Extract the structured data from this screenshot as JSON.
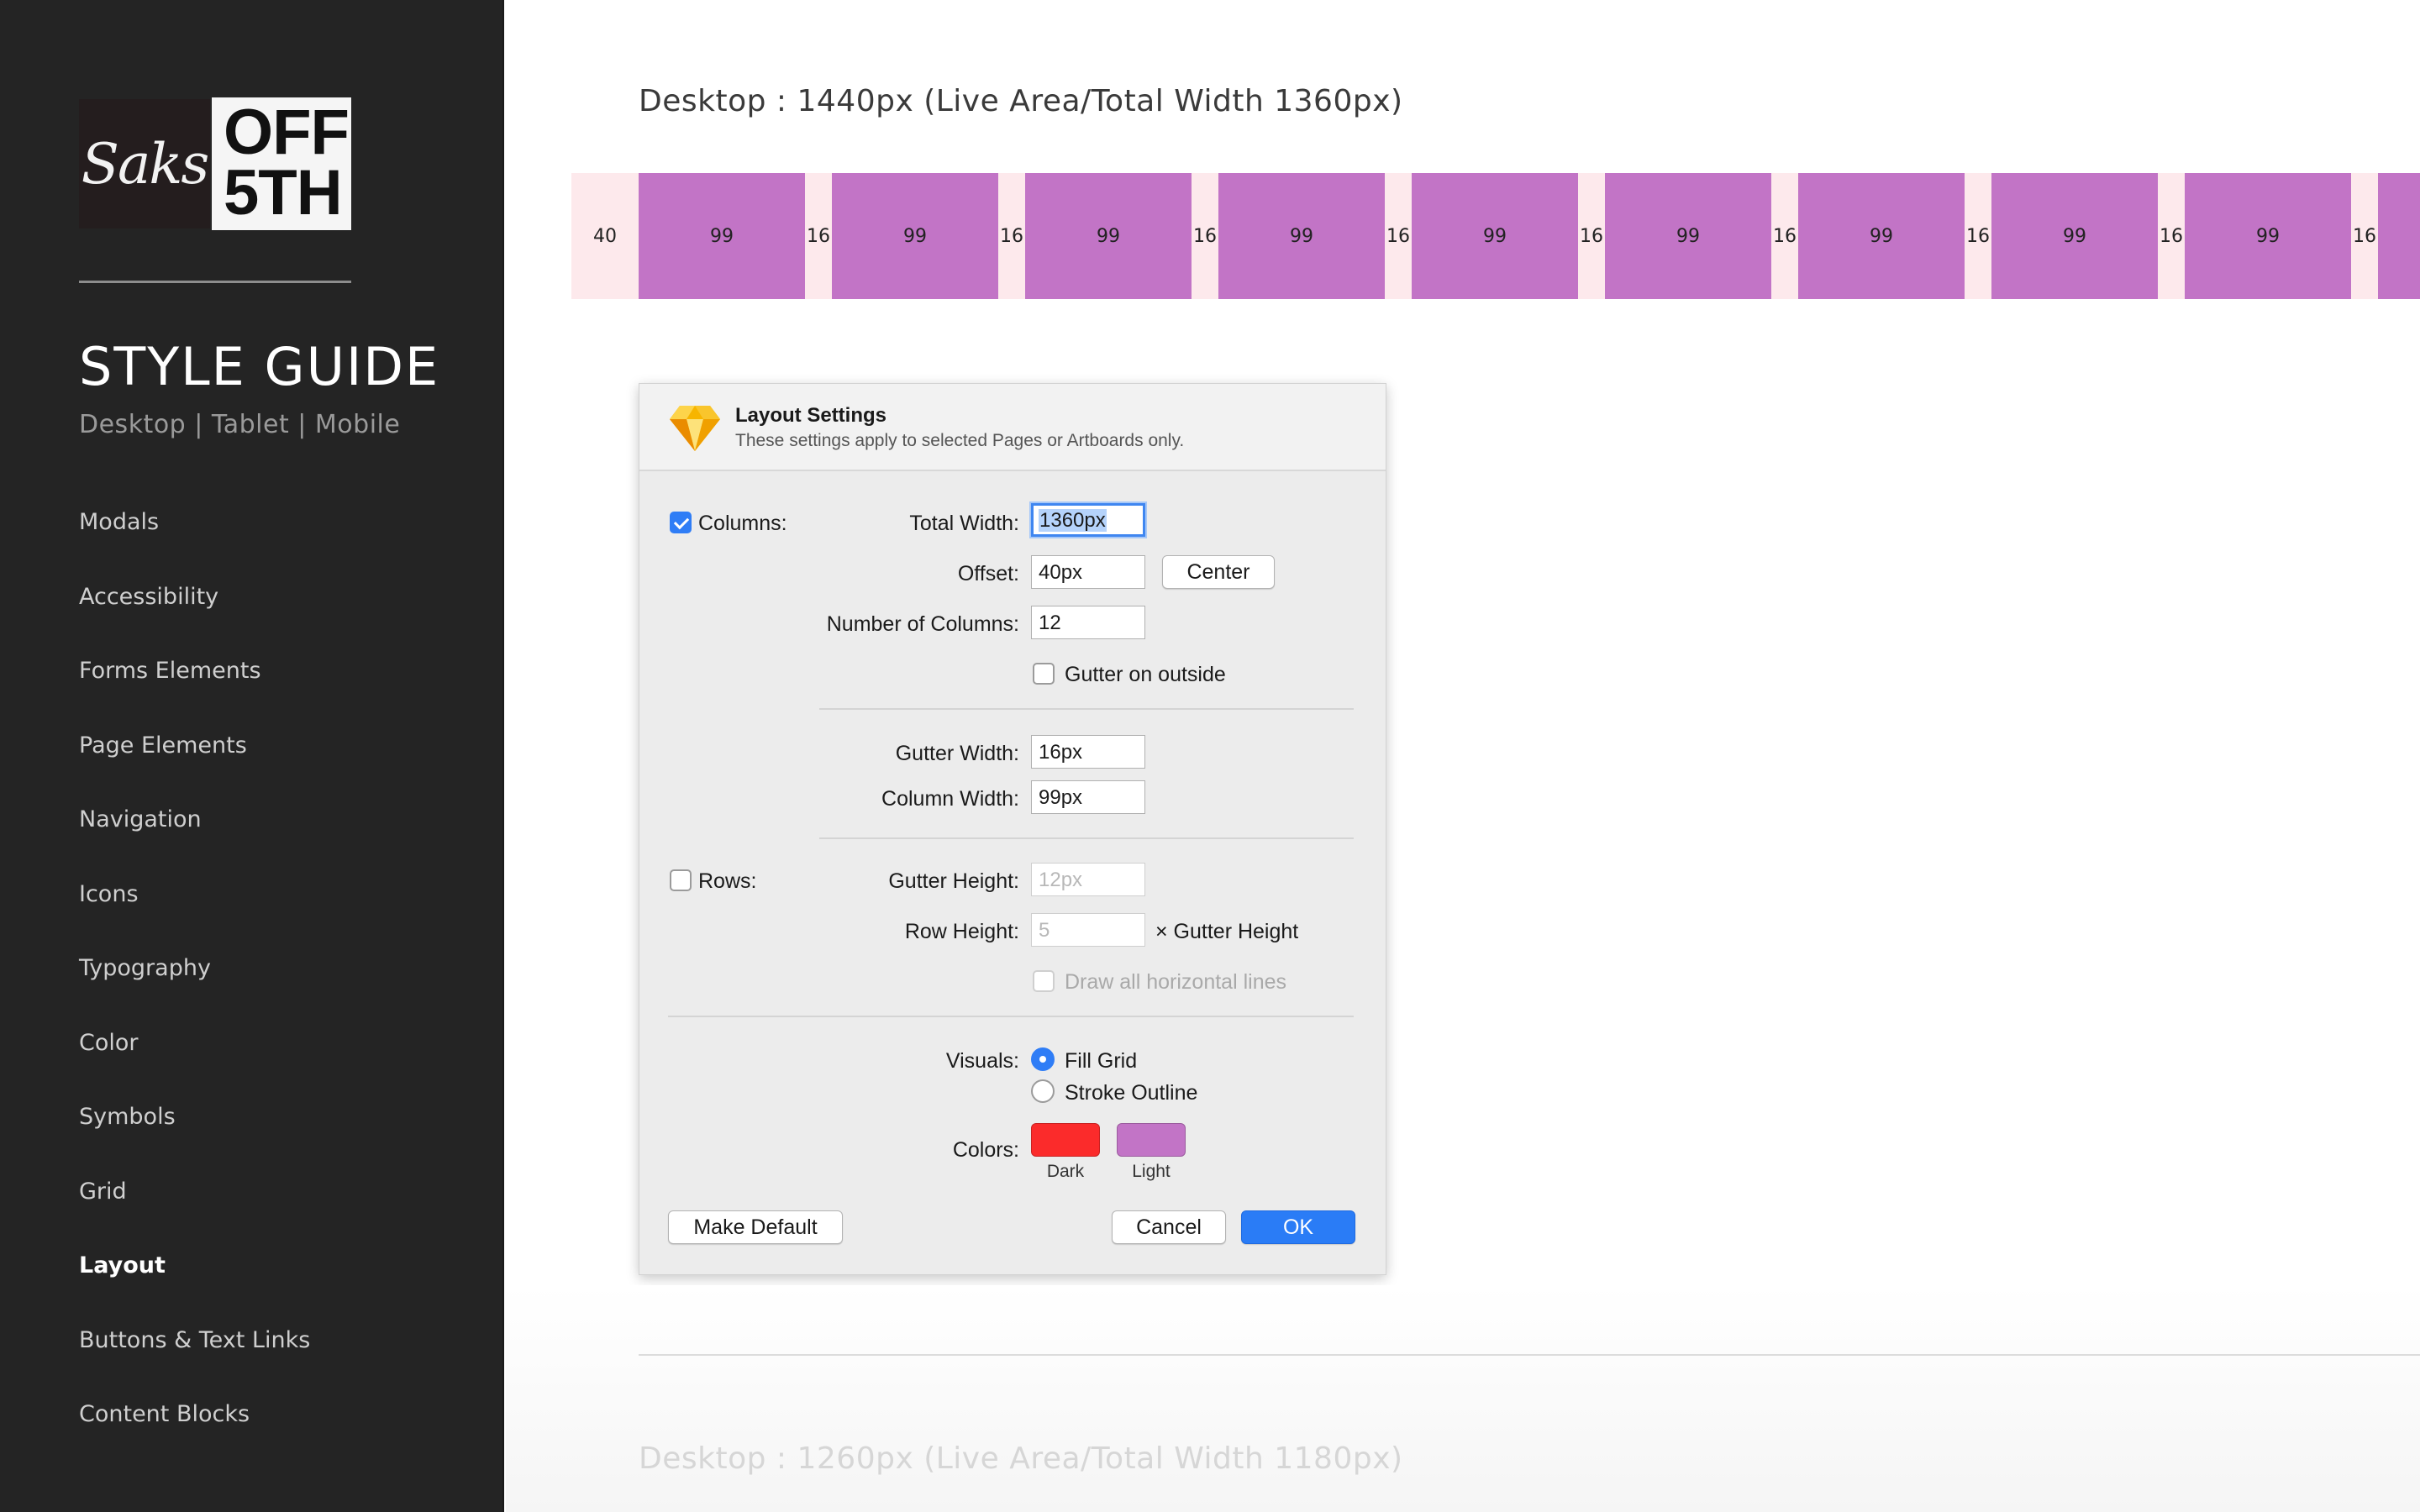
{
  "sidebar": {
    "logo_saks": "Saks",
    "logo_off": "OFF",
    "logo_5th": "5TH",
    "title": "STYLE GUIDE",
    "subtitle": "Desktop | Tablet | Mobile",
    "nav": [
      {
        "label": "Modals",
        "active": false
      },
      {
        "label": "Accessibility",
        "active": false
      },
      {
        "label": "Forms Elements",
        "active": false
      },
      {
        "label": "Page Elements",
        "active": false
      },
      {
        "label": "Navigation",
        "active": false
      },
      {
        "label": "Icons",
        "active": false
      },
      {
        "label": "Typography",
        "active": false
      },
      {
        "label": "Color",
        "active": false
      },
      {
        "label": "Symbols",
        "active": false
      },
      {
        "label": "Grid",
        "active": false
      },
      {
        "label": "Layout",
        "active": true
      },
      {
        "label": "Buttons & Text Links",
        "active": false
      },
      {
        "label": "Content Blocks",
        "active": false
      }
    ]
  },
  "main": {
    "section_title": "Desktop : 1440px (Live Area/Total Width 1360px)",
    "grid_strip": [
      "40",
      "99",
      "16",
      "99",
      "16",
      "99",
      "16",
      "99",
      "16",
      "99",
      "16",
      "99",
      "16",
      "99",
      "16",
      "99",
      "16",
      "99",
      "16"
    ],
    "lower_title": "Desktop : 1260px (Live Area/Total Width 1180px)"
  },
  "dialog": {
    "icon": "sketch-diamond-icon",
    "title": "Layout Settings",
    "subtitle": "These settings apply to selected Pages or Artboards only.",
    "columns_label": "Columns:",
    "columns_checked": true,
    "total_width_label": "Total Width:",
    "total_width_value": "1360px",
    "offset_label": "Offset:",
    "offset_value": "40px",
    "center_label": "Center",
    "num_columns_label": "Number of Columns:",
    "num_columns_value": "12",
    "gutter_outside_label": "Gutter on outside",
    "gutter_outside_checked": false,
    "gutter_width_label": "Gutter Width:",
    "gutter_width_value": "16px",
    "column_width_label": "Column Width:",
    "column_width_value": "99px",
    "rows_label": "Rows:",
    "rows_checked": false,
    "gutter_height_label": "Gutter Height:",
    "gutter_height_placeholder": "12px",
    "row_height_label": "Row Height:",
    "row_height_placeholder": "5",
    "row_height_suffix": "× Gutter Height",
    "draw_lines_label": "Draw all horizontal lines",
    "visuals_label": "Visuals:",
    "visual_fill": "Fill Grid",
    "visual_stroke": "Stroke Outline",
    "visual_selected": "Fill Grid",
    "colors_label": "Colors:",
    "color_dark_label": "Dark",
    "color_light_label": "Light",
    "color_dark": "#fb2b2b",
    "color_light": "#c274c6",
    "make_default_label": "Make Default",
    "cancel_label": "Cancel",
    "ok_label": "OK"
  }
}
